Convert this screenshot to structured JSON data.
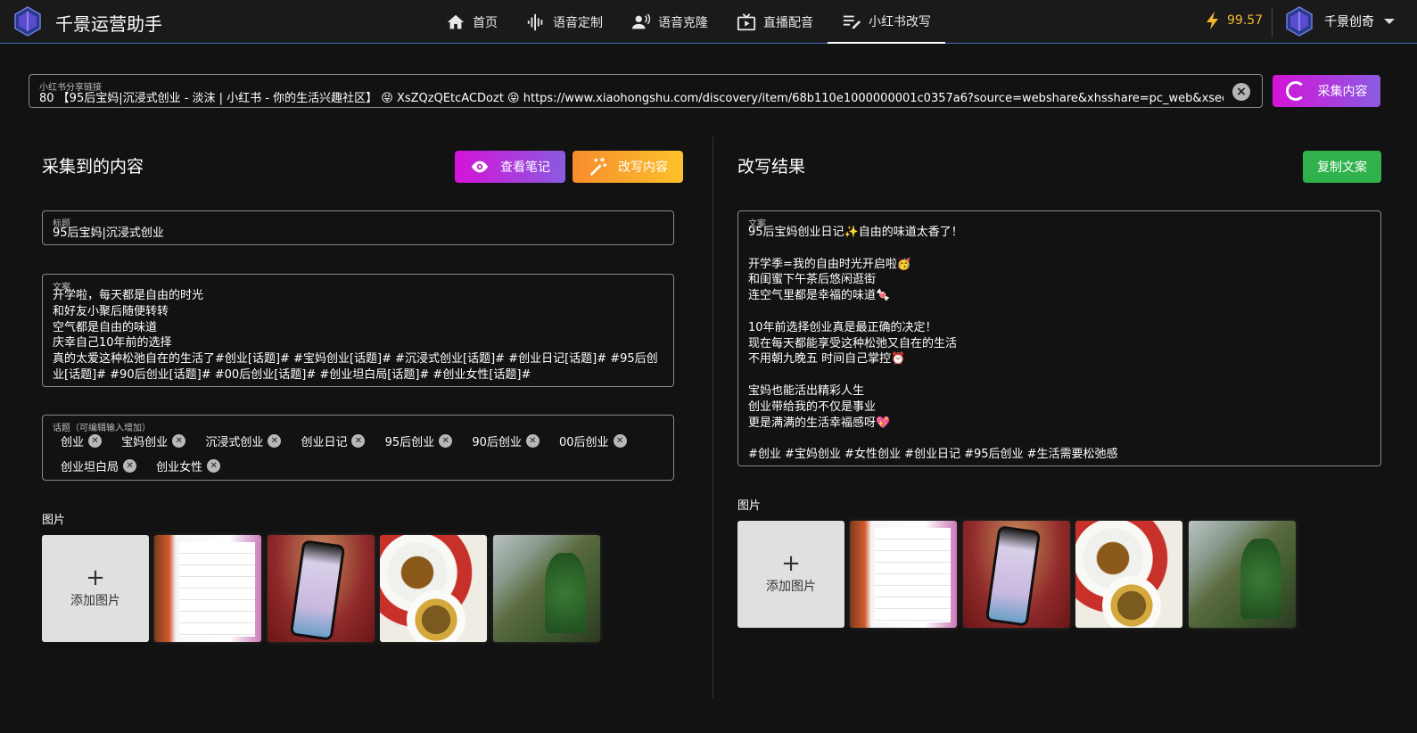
{
  "app": {
    "title": "千景运营助手"
  },
  "nav": [
    {
      "label": "首页",
      "icon": "home-icon"
    },
    {
      "label": "语音定制",
      "icon": "voice-wave-icon"
    },
    {
      "label": "语音克隆",
      "icon": "voice-clone-icon"
    },
    {
      "label": "直播配音",
      "icon": "live-tv-icon"
    },
    {
      "label": "小红书改写",
      "icon": "edit-note-icon",
      "active": true
    }
  ],
  "credits": "99.57",
  "user": {
    "name": "千景创奇"
  },
  "url_field": {
    "label": "小红书分享链接",
    "value": "80 【95后宝妈|沉浸式创业 - 淡沫 | 小红书 - 你的生活兴趣社区】 😝 XsZQzQEtcACDozt 😝 https://www.xiaohongshu.com/discovery/item/68b110e1000000001c0357a6?source=webshare&xhsshare=pc_web&xsec_token=...",
    "collect_label": "采集内容"
  },
  "left": {
    "title": "采集到的内容",
    "view_label": "查看笔记",
    "rewrite_label": "改写内容",
    "title_field": {
      "label": "标题",
      "value": "95后宝妈|沉浸式创业"
    },
    "copy_field": {
      "label": "文案",
      "value": "开学啦，每天都是自由的时光\n和好友小聚后随便转转\n空气都是自由的味道\n庆幸自己10年前的选择\n真的太爱这种松弛自在的生活了#创业[话题]# #宝妈创业[话题]# #沉浸式创业[话题]# #创业日记[话题]# #95后创\n业[话题]# #90后创业[话题]# #00后创业[话题]# #创业坦白局[话题]# #创业女性[话题]#"
    },
    "topics": {
      "label": "话题（可编辑输入增加）",
      "items": [
        "创业",
        "宝妈创业",
        "沉浸式创业",
        "创业日记",
        "95后创业",
        "90后创业",
        "00后创业",
        "创业坦白局",
        "创业女性"
      ]
    },
    "images_label": "图片",
    "add_image_label": "添加图片"
  },
  "right": {
    "title": "改写结果",
    "copy_button": "复制文案",
    "result_field": {
      "label": "文案",
      "value": "95后宝妈创业日记✨自由的味道太香了！\n\n开学季=我的自由时光开启啦🥳\n和闺蜜下午茶后悠闲逛街\n连空气里都是幸福的味道🍬\n\n10年前选择创业真是最正确的决定！\n现在每天都能享受这种松弛又自在的生活\n不用朝九晚五 时间自己掌控⏰\n\n宝妈也能活出精彩人生\n创业带给我的不仅是事业\n更是满满的生活幸福感呀💖\n\n#创业 #宝妈创业 #女性创业 #创业日记 #95后创业 #生活需要松弛感"
    },
    "images_label": "图片",
    "add_image_label": "添加图片"
  },
  "colors": {
    "accent_purple": "#d413d8",
    "accent_orange": "#f78c2c",
    "accent_green": "#2fb24c",
    "credits": "#f5b82e"
  }
}
